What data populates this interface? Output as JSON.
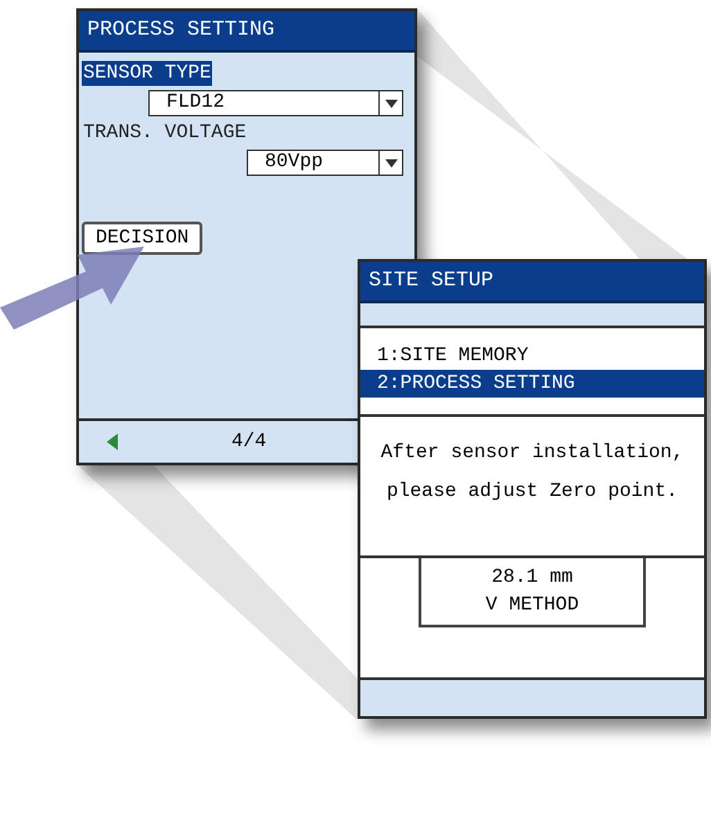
{
  "process_screen": {
    "title": "PROCESS SETTING",
    "fields": [
      {
        "label": "SENSOR TYPE",
        "selected": true,
        "value": "FLD12",
        "kind": "wide"
      },
      {
        "label": "TRANS. VOLTAGE",
        "selected": false,
        "value": "80Vpp",
        "kind": "narrow"
      }
    ],
    "button": "DECISION",
    "page": "4/4"
  },
  "site_screen": {
    "title": "SITE SETUP",
    "menu": [
      {
        "label": "1:SITE MEMORY",
        "selected": false
      },
      {
        "label": "2:PROCESS SETTING",
        "selected": true
      }
    ],
    "message": [
      "After sensor installation,",
      "please adjust Zero point."
    ],
    "spacing": [
      "28.1 mm",
      "V METHOD"
    ]
  }
}
